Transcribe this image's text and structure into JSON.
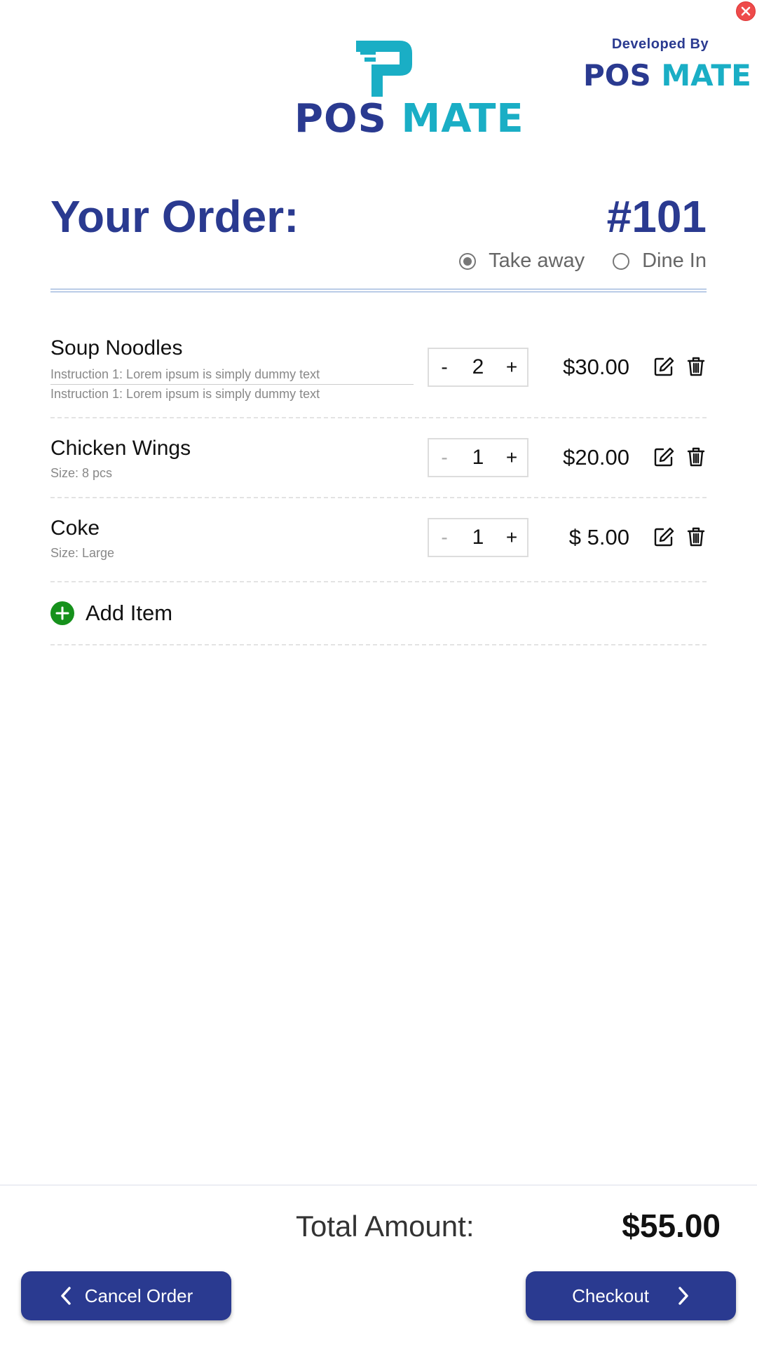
{
  "header": {
    "logo": {
      "word1": "POS",
      "word2": "MATE"
    },
    "developed_by": {
      "label": "Developed By",
      "word1": "POS",
      "word2": "MATE"
    }
  },
  "order": {
    "title": "Your Order:",
    "number": "#101",
    "type_options": [
      {
        "label": "Take away",
        "selected": true
      },
      {
        "label": "Dine In",
        "selected": false
      }
    ]
  },
  "items": [
    {
      "name": "Soup Noodles",
      "instructions": [
        "Instruction 1: Lorem ipsum is simply dummy text",
        "Instruction 1: Lorem ipsum is simply dummy text"
      ],
      "quantity": "2",
      "minus": "-",
      "plus": "+",
      "price": "$30.00"
    },
    {
      "name": "Chicken Wings",
      "meta": "Size: 8 pcs",
      "quantity": "1",
      "minus": "-",
      "plus": "+",
      "price": "$20.00"
    },
    {
      "name": "Coke",
      "meta": "Size: Large",
      "quantity": "1",
      "minus": "-",
      "plus": "+",
      "price": "$ 5.00"
    }
  ],
  "add_item": {
    "label": "Add Item"
  },
  "footer": {
    "total_label": "Total Amount:",
    "total_value": "$55.00",
    "cancel_label": "Cancel Order",
    "checkout_label": "Checkout"
  },
  "colors": {
    "brand_navy": "#2a3a90",
    "brand_teal": "#1aaec5",
    "add_green": "#16911c",
    "close_red": "#ee4b4b"
  },
  "icons": [
    "close-icon",
    "logo-p-icon",
    "edit-icon",
    "trash-icon",
    "plus-circle-icon",
    "chevron-left-icon",
    "chevron-right-icon"
  ]
}
